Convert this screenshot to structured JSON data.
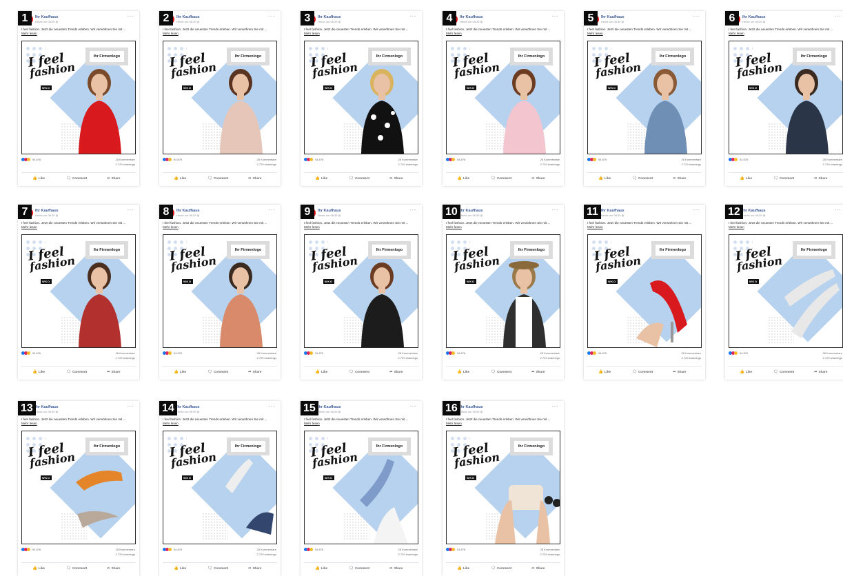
{
  "post": {
    "page_name": "Ihr Kaufhaus",
    "time": "Heute um 08:39 ◍",
    "text": "I feel fashion. Jetzt die neuesten Trends erleben. Wir verwöhnen Sie mit ...",
    "read_more": "Mehr lesen",
    "more_icon": "···",
    "logo_placeholder": "Ihr Firmenlogo",
    "slogan_line1": "I feel",
    "slogan_line2": "fashion",
    "org_logo": "WKO",
    "reaction_count": "54.876",
    "comments": "28 Kommentare",
    "shares": "2.729 shareings",
    "like": "Like",
    "comment": "Comment",
    "share": "Share",
    "like_icon": "thumbs-up-icon",
    "comment_icon": "speech-bubble-icon",
    "share_icon": "share-arrow-icon"
  },
  "colors": {
    "avatar": "#e8141c",
    "diamond": "#b7d2ee",
    "link": "#3b5998",
    "badge": "#0a0a0a"
  },
  "cards": [
    {
      "number": "1",
      "subject": "woman in red dress"
    },
    {
      "number": "2",
      "subject": "woman in floral blouse"
    },
    {
      "number": "3",
      "subject": "blonde woman in polka dot top"
    },
    {
      "number": "4",
      "subject": "woman with pink jacket"
    },
    {
      "number": "5",
      "subject": "woman in denim jacket"
    },
    {
      "number": "6",
      "subject": "man in blazer"
    },
    {
      "number": "7",
      "subject": "man in plaid shirt"
    },
    {
      "number": "8",
      "subject": "man in floral shirt"
    },
    {
      "number": "9",
      "subject": "woman in dirndl"
    },
    {
      "number": "10",
      "subject": "man in traditional vest with hat"
    },
    {
      "number": "11",
      "subject": "hand holding red high heel"
    },
    {
      "number": "12",
      "subject": "legs in sneakers"
    },
    {
      "number": "13",
      "subject": "two high heels"
    },
    {
      "number": "14",
      "subject": "legs in white sneakers"
    },
    {
      "number": "15",
      "subject": "legs in blue heels"
    },
    {
      "number": "16",
      "subject": "hands holding handbag and sunglasses"
    }
  ]
}
